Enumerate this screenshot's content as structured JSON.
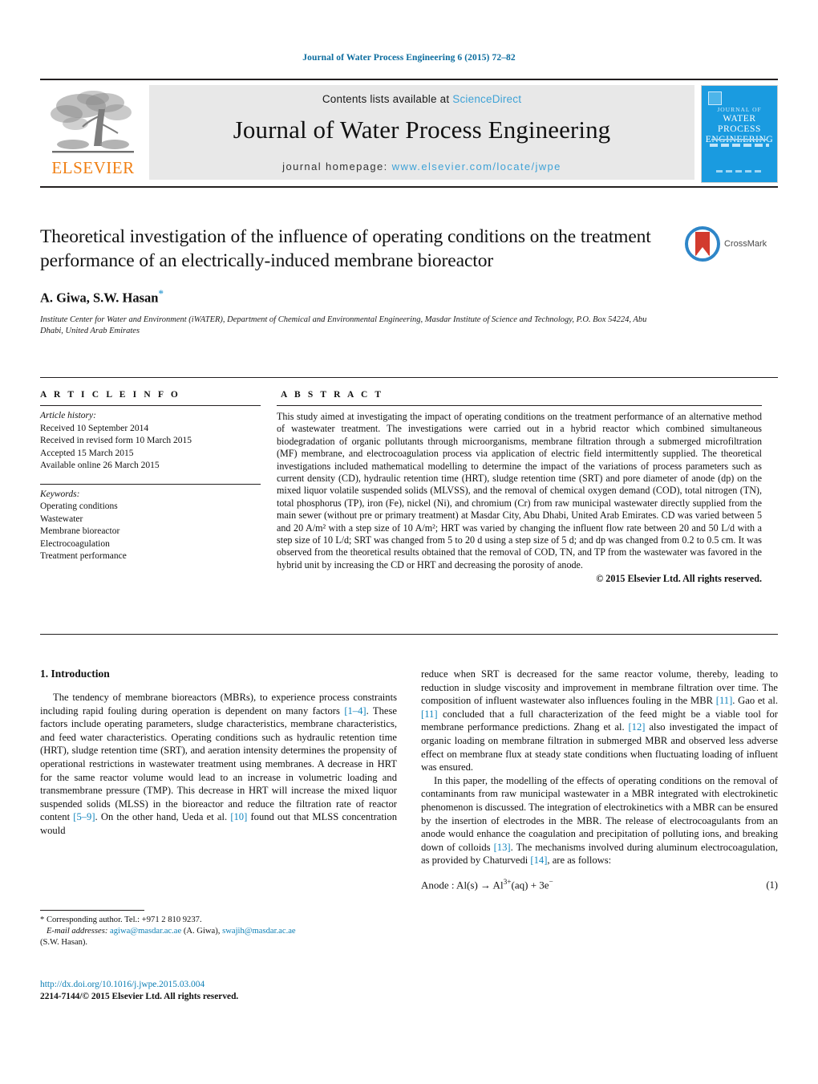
{
  "running_head": "Journal of Water Process Engineering 6 (2015) 72–82",
  "masthead": {
    "publisher": "ELSEVIER",
    "contents_prefix": "Contents lists available at ",
    "contents_link": "ScienceDirect",
    "journal_title": "Journal of Water Process Engineering",
    "homepage_prefix": "journal homepage: ",
    "homepage_url": "www.elsevier.com/locate/jwpe",
    "cover": {
      "line_top": "JOURNAL OF",
      "line_main": "WATER PROCESS ENGINEERING",
      "color": "#1a9be0"
    }
  },
  "article": {
    "title": "Theoretical investigation of the influence of operating conditions on the treatment performance of an electrically-induced membrane bioreactor",
    "authors": "A. Giwa, S.W. Hasan",
    "corresponding_marker": "*",
    "affiliation": "Institute Center for Water and Environment (iWATER), Department of Chemical and Environmental Engineering, Masdar Institute of Science and Technology, P.O. Box 54224, Abu Dhabi, United Arab Emirates",
    "crossmark_label": "CrossMark"
  },
  "info": {
    "heading": "A R T I C L E  I N F O",
    "history_label": "Article history:",
    "history": [
      "Received 10 September 2014",
      "Received in revised form 10 March 2015",
      "Accepted 15 March 2015",
      "Available online 26 March 2015"
    ],
    "keywords_label": "Keywords:",
    "keywords": [
      "Operating conditions",
      "Wastewater",
      "Membrane bioreactor",
      "Electrocoagulation",
      "Treatment performance"
    ]
  },
  "abstract": {
    "heading": "A B S T R A C T",
    "text": "This study aimed at investigating the impact of operating conditions on the treatment performance of an alternative method of wastewater treatment. The investigations were carried out in a hybrid reactor which combined simultaneous biodegradation of organic pollutants through microorganisms, membrane filtration through a submerged microfiltration (MF) membrane, and electrocoagulation process via application of electric field intermittently supplied. The theoretical investigations included mathematical modelling to determine the impact of the variations of process parameters such as current density (CD), hydraulic retention time (HRT), sludge retention time (SRT) and pore diameter of anode (dp) on the mixed liquor volatile suspended solids (MLVSS), and the removal of chemical oxygen demand (COD), total nitrogen (TN), total phosphorus (TP), iron (Fe), nickel (Ni), and chromium (Cr) from raw municipal wastewater directly supplied from the main sewer (without pre or primary treatment) at Masdar City, Abu Dhabi, United Arab Emirates. CD was varied between 5 and 20 A/m² with a step size of 10 A/m²; HRT was varied by changing the influent flow rate between 20 and 50 L/d with a step size of 10 L/d; SRT was changed from 5 to 20 d using a step size of 5 d; and dp was changed from 0.2 to 0.5 cm. It was observed from the theoretical results obtained that the removal of COD, TN, and TP from the wastewater was favored in the hybrid unit by increasing the CD or HRT and decreasing the porosity of anode.",
    "copyright": "© 2015 Elsevier Ltd. All rights reserved."
  },
  "introduction": {
    "heading": "1.  Introduction",
    "left_para_1_a": "The tendency of membrane bioreactors (MBRs), to experience process constraints including rapid fouling during operation is dependent on many factors ",
    "left_ref_1": "[1–4]",
    "left_para_1_b": ". These factors include operating parameters, sludge characteristics, membrane characteristics, and feed water characteristics. Operating conditions such as hydraulic retention time (HRT), sludge retention time (SRT), and aeration intensity determines the propensity of operational restrictions in wastewater treatment using membranes. A decrease in HRT for the same reactor volume would lead to an increase in volumetric loading and transmembrane pressure (TMP). This decrease in HRT will increase the mixed liquor suspended solids (MLSS) in the bioreactor and reduce the filtration rate of reactor content ",
    "left_ref_2": "[5–9]",
    "left_para_1_c": ". On the other hand, Ueda et al. ",
    "left_ref_3": "[10]",
    "left_para_1_d": " found out that MLSS concentration would",
    "right_para_1_a": "reduce when SRT is decreased for the same reactor volume, thereby, leading to reduction in sludge viscosity and improvement in membrane filtration over time. The composition of influent wastewater also influences fouling in the MBR ",
    "right_ref_1": "[11]",
    "right_para_1_b": ". Gao et al. ",
    "right_ref_2": "[11]",
    "right_para_1_c": " concluded that a full characterization of the feed might be a viable tool for membrane performance predictions. Zhang et al. ",
    "right_ref_3": "[12]",
    "right_para_1_d": " also investigated the impact of organic loading on membrane filtration in submerged MBR and observed less adverse effect on membrane flux at steady state conditions when fluctuating loading of influent was ensured.",
    "right_para_2_a": "In this paper, the modelling of the effects of operating conditions on the removal of contaminants from raw municipal wastewater in a MBR integrated with electrokinetic phenomenon is discussed. The integration of electrokinetics with a MBR can be ensured by the insertion of electrodes in the MBR. The release of electrocoagulants from an anode would enhance the coagulation and precipitation of polluting ions, and breaking down of colloids ",
    "right_ref_4": "[13]",
    "right_para_2_b": ". The mechanisms involved during aluminum electrocoagulation, as provided by Chaturvedi ",
    "right_ref_5": "[14]",
    "right_para_2_c": ", are as follows:",
    "equation_1_text": "Anode : Al(s) → Al",
    "equation_1_sup": "3+",
    "equation_1_tail": "(aq) + 3e",
    "equation_1_tail_sup": "−",
    "equation_1_number": "(1)"
  },
  "footnotes": {
    "corresponding": "* Corresponding author. Tel.: +971 2 810 9237.",
    "email_label": "E-mail addresses:",
    "email_1": "agiwa@masdar.ac.ae",
    "email_1_owner": " (A. Giwa), ",
    "email_2": "swajih@masdar.ac.ae",
    "email_2_owner": "(S.W. Hasan).",
    "doi": "http://dx.doi.org/10.1016/j.jwpe.2015.03.004",
    "issn": "2214-7144/© 2015 Elsevier Ltd. All rights reserved."
  }
}
